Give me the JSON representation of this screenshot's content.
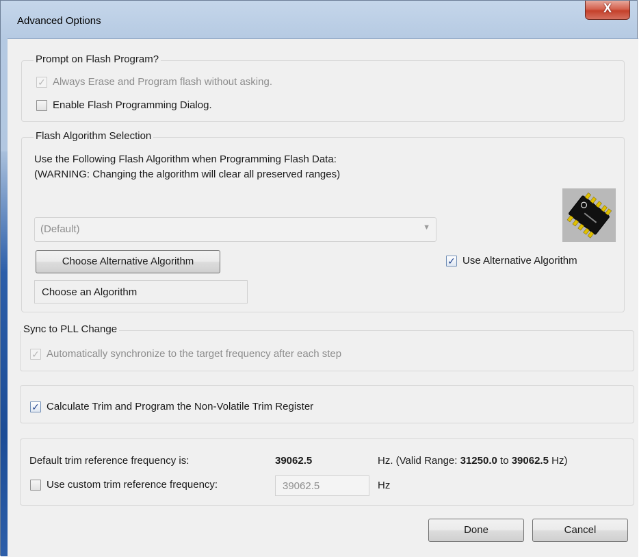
{
  "window": {
    "title": "Advanced Options",
    "close_label": "X"
  },
  "prompt_group": {
    "legend": "Prompt on Flash Program?",
    "always_erase_label": "Always Erase and Program flash without asking.",
    "always_erase_checked": true,
    "enable_dialog_label": "Enable Flash Programming Dialog.",
    "enable_dialog_checked": false
  },
  "algorithm_group": {
    "legend": "Flash Algorithm Selection",
    "description_line1": "Use the Following Flash Algorithm when Programming Flash Data:",
    "description_line2": "(WARNING: Changing the algorithm will clear all preserved ranges)",
    "dropdown_value": "(Default)",
    "choose_button_label": "Choose Alternative Algorithm",
    "algorithm_field_value": "Choose an Algorithm",
    "use_alternative_label": "Use Alternative Algorithm",
    "use_alternative_checked": true,
    "chip_icon": "chip-icon"
  },
  "sync_group": {
    "legend": "Sync to PLL Change",
    "auto_sync_label": "Automatically synchronize to the target frequency after each step",
    "auto_sync_checked": true
  },
  "trim_group": {
    "calc_trim_label": "Calculate Trim and Program the Non-Volatile Trim Register",
    "calc_trim_checked": true
  },
  "freq_group": {
    "default_label": "Default trim reference frequency is:",
    "default_value": "39062.5",
    "range_prefix": "Hz. (Valid Range:",
    "range_min": "31250.0",
    "range_to": "to",
    "range_max": "39062.5",
    "range_suffix": "Hz)",
    "custom_label": "Use custom trim reference frequency:",
    "custom_checked": false,
    "custom_value": "39062.5",
    "custom_unit": "Hz"
  },
  "buttons": {
    "done_label": "Done",
    "cancel_label": "Cancel"
  }
}
